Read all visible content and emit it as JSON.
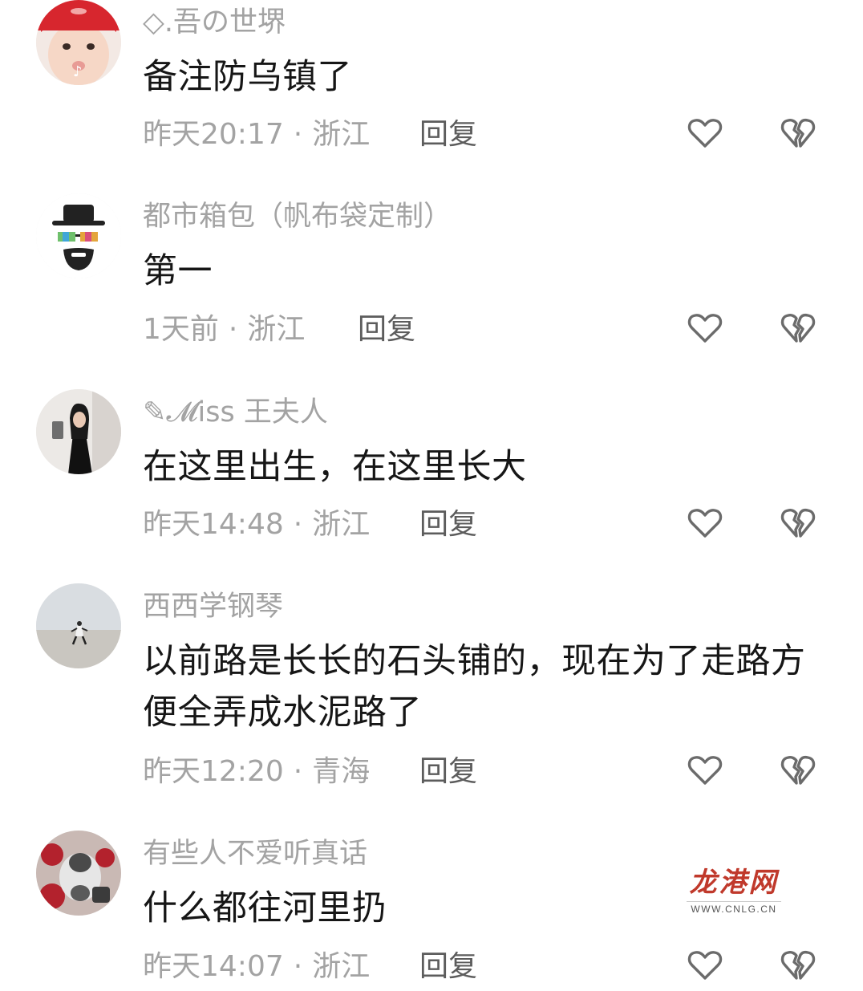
{
  "comments": [
    {
      "username": "◇.吾の世堺",
      "text": "备注防乌镇了",
      "time": "昨天20:17",
      "location": "浙江",
      "reply_label": "回复",
      "avatar": "child-red-hat-avatar"
    },
    {
      "username": "都市箱包（帆布袋定制）",
      "text": "第一",
      "time": "1天前",
      "location": "浙江",
      "reply_label": "回复",
      "avatar": "hat-sunglasses-beard-avatar"
    },
    {
      "username": "✎𝓜iss 王夫人",
      "text": "在这里出生，在这里长大",
      "time": "昨天14:48",
      "location": "浙江",
      "reply_label": "回复",
      "avatar": "woman-selfie-avatar"
    },
    {
      "username": "西西学钢琴",
      "text": "以前路是长长的石头铺的，现在为了走路方便全弄成水泥路了",
      "time": "昨天12:20",
      "location": "青海",
      "reply_label": "回复",
      "avatar": "beach-walker-avatar"
    },
    {
      "username": "有些人不爱听真话",
      "text": "什么都往河里扔",
      "time": "昨天14:07",
      "location": "浙江",
      "reply_label": "回复",
      "avatar": "stuffed-toy-avatar"
    }
  ],
  "separator": "·",
  "watermark": {
    "logo": "龙港网",
    "url": "WWW.CNLG.CN"
  },
  "icons": {
    "like": "heart-outline-icon",
    "dislike": "broken-heart-icon"
  },
  "colors": {
    "text": "#161616",
    "meta": "#a3a3a3",
    "reply": "#5c5c5c",
    "icon": "#6b6b6b",
    "watermark": "#c0392b"
  }
}
